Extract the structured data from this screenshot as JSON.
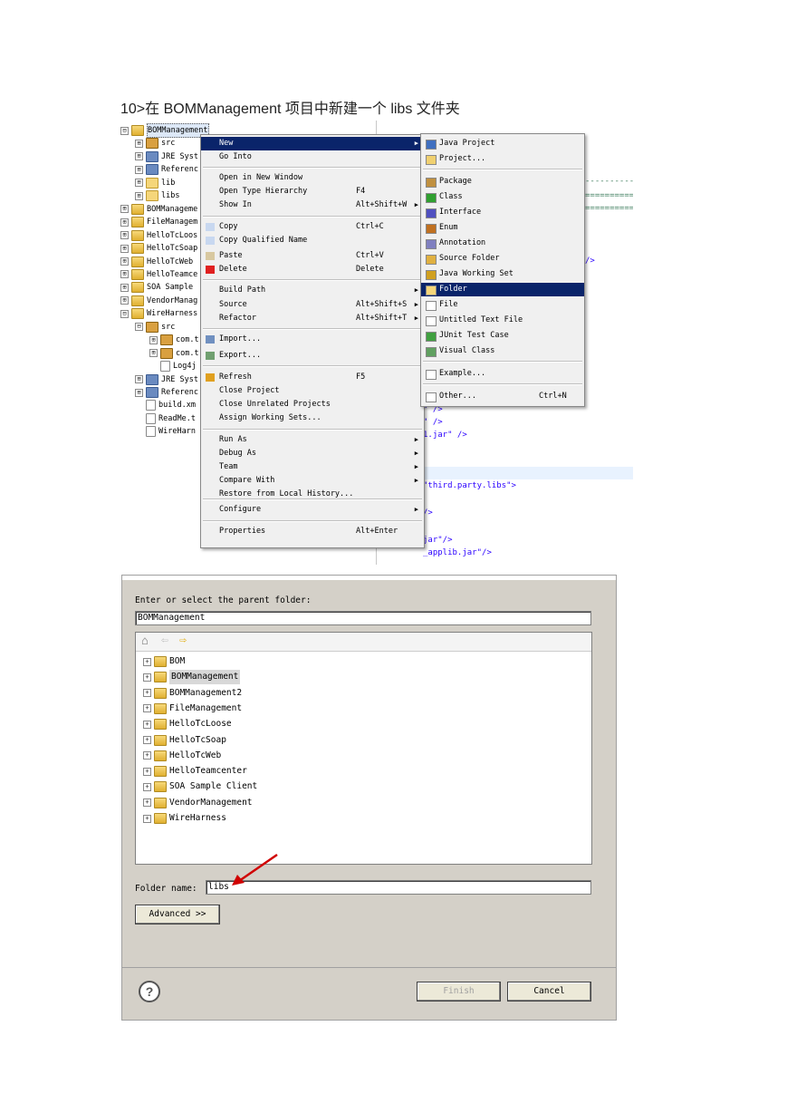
{
  "heading": "10>在 BOMManagement 项目中新建一个 libs 文件夹",
  "explorer": {
    "rows": [
      {
        "label": "BOMManagement",
        "exp": "⊟",
        "indent": 0,
        "icon": "proj"
      },
      {
        "label": "src",
        "exp": "⊞",
        "indent": 1,
        "icon": "pkg"
      },
      {
        "label": "JRE Syst",
        "exp": "⊞",
        "indent": 1,
        "icon": "lib"
      },
      {
        "label": "Referenc",
        "exp": "⊞",
        "indent": 1,
        "icon": "lib"
      },
      {
        "label": "lib",
        "exp": "⊞",
        "indent": 1,
        "icon": "fold"
      },
      {
        "label": "libs",
        "exp": "⊞",
        "indent": 1,
        "icon": "fold"
      },
      {
        "label": "BOMManageme",
        "exp": "⊞",
        "indent": 0,
        "icon": "proj"
      },
      {
        "label": "FileManagem",
        "exp": "⊞",
        "indent": 0,
        "icon": "proj"
      },
      {
        "label": "HelloTcLoos",
        "exp": "⊞",
        "indent": 0,
        "icon": "proj"
      },
      {
        "label": "HelloTcSoap",
        "exp": "⊞",
        "indent": 0,
        "icon": "proj"
      },
      {
        "label": "HelloTcWeb",
        "exp": "⊞",
        "indent": 0,
        "icon": "proj"
      },
      {
        "label": "HelloTeamce",
        "exp": "⊞",
        "indent": 0,
        "icon": "proj"
      },
      {
        "label": "SOA Sample",
        "exp": "⊞",
        "indent": 0,
        "icon": "proj"
      },
      {
        "label": "VendorManag",
        "exp": "⊞",
        "indent": 0,
        "icon": "proj"
      },
      {
        "label": "WireHarness",
        "exp": "⊟",
        "indent": 0,
        "icon": "proj"
      },
      {
        "label": "src",
        "exp": "⊟",
        "indent": 1,
        "icon": "pkg"
      },
      {
        "label": "com.t",
        "exp": "⊞",
        "indent": 2,
        "icon": "pkg"
      },
      {
        "label": "com.t",
        "exp": "⊞",
        "indent": 2,
        "icon": "pkg"
      },
      {
        "label": "Log4j",
        "exp": "",
        "indent": 2,
        "icon": "file"
      },
      {
        "label": "JRE Syst",
        "exp": "⊞",
        "indent": 1,
        "icon": "lib"
      },
      {
        "label": "Referenc",
        "exp": "⊞",
        "indent": 1,
        "icon": "lib"
      },
      {
        "label": "build.xm",
        "exp": "",
        "indent": 1,
        "icon": "file"
      },
      {
        "label": "ReadMe.t",
        "exp": "",
        "indent": 1,
        "icon": "file"
      },
      {
        "label": "WireHarn",
        "exp": "",
        "indent": 1,
        "icon": "file"
      }
    ]
  },
  "editor": {
    "dashes": "==========",
    "dashes2": "----------",
    "line_a": "/>",
    "line_b": "\" />",
    "line_c": "\" />",
    "line_d": "1.jar\" />",
    "line_e": "\"third.party.libs\">",
    "line_f": "/>",
    "line_g": "jar\"/>",
    "line_h": "_applib.jar\"/>"
  },
  "context_menu": {
    "items": [
      {
        "label": "New",
        "shortcut": "",
        "submenu": true,
        "highlight": true
      },
      {
        "label": "Go Into",
        "shortcut": "",
        "submenu": false
      },
      {
        "label": "Open in New Window",
        "shortcut": "",
        "submenu": false
      },
      {
        "label": "Open Type Hierarchy",
        "shortcut": "F4",
        "submenu": false
      },
      {
        "label": "Show In",
        "shortcut": "Alt+Shift+W",
        "submenu": true
      },
      {
        "label": "Copy",
        "shortcut": "Ctrl+C",
        "submenu": false
      },
      {
        "label": "Copy Qualified Name",
        "shortcut": "",
        "submenu": false
      },
      {
        "label": "Paste",
        "shortcut": "Ctrl+V",
        "submenu": false
      },
      {
        "label": "Delete",
        "shortcut": "Delete",
        "submenu": false
      },
      {
        "label": "Build Path",
        "shortcut": "",
        "submenu": true
      },
      {
        "label": "Source",
        "shortcut": "Alt+Shift+S",
        "submenu": true
      },
      {
        "label": "Refactor",
        "shortcut": "Alt+Shift+T",
        "submenu": true
      },
      {
        "label": "Import...",
        "shortcut": "",
        "submenu": false
      },
      {
        "label": "Export...",
        "shortcut": "",
        "submenu": false
      },
      {
        "label": "Refresh",
        "shortcut": "F5",
        "submenu": false
      },
      {
        "label": "Close Project",
        "shortcut": "",
        "submenu": false
      },
      {
        "label": "Close Unrelated Projects",
        "shortcut": "",
        "submenu": false
      },
      {
        "label": "Assign Working Sets...",
        "shortcut": "",
        "submenu": false
      },
      {
        "label": "Run As",
        "shortcut": "",
        "submenu": true
      },
      {
        "label": "Debug As",
        "shortcut": "",
        "submenu": true
      },
      {
        "label": "Team",
        "shortcut": "",
        "submenu": true
      },
      {
        "label": "Compare With",
        "shortcut": "",
        "submenu": true
      },
      {
        "label": "Restore from Local History...",
        "shortcut": "",
        "submenu": false
      },
      {
        "label": "Configure",
        "shortcut": "",
        "submenu": true
      },
      {
        "label": "Properties",
        "shortcut": "Alt+Enter",
        "submenu": false
      }
    ]
  },
  "new_submenu": {
    "items": [
      {
        "label": "Java Project",
        "shortcut": ""
      },
      {
        "label": "Project...",
        "shortcut": ""
      },
      {
        "label": "Package",
        "shortcut": ""
      },
      {
        "label": "Class",
        "shortcut": ""
      },
      {
        "label": "Interface",
        "shortcut": ""
      },
      {
        "label": "Enum",
        "shortcut": ""
      },
      {
        "label": "Annotation",
        "shortcut": ""
      },
      {
        "label": "Source Folder",
        "shortcut": ""
      },
      {
        "label": "Java Working Set",
        "shortcut": ""
      },
      {
        "label": "Folder",
        "shortcut": "",
        "highlight": true
      },
      {
        "label": "File",
        "shortcut": ""
      },
      {
        "label": "Untitled Text File",
        "shortcut": ""
      },
      {
        "label": "JUnit Test Case",
        "shortcut": ""
      },
      {
        "label": "Visual Class",
        "shortcut": ""
      },
      {
        "label": "Example...",
        "shortcut": ""
      },
      {
        "label": "Other...",
        "shortcut": "Ctrl+N"
      }
    ]
  },
  "dialog": {
    "parent_label": "Enter or select the parent folder:",
    "parent_value": "BOMManagement",
    "projects": [
      "BOM",
      "BOMManagement",
      "BOMManagement2",
      "FileManagement",
      "HelloTcLoose",
      "HelloTcSoap",
      "HelloTcWeb",
      "HelloTeamcenter",
      "SOA Sample Client",
      "VendorManagement",
      "WireHarness"
    ],
    "selected_project": "BOMManagement",
    "folder_label": "Folder name:",
    "folder_value": "libs",
    "advanced": "Advanced >>",
    "finish": "Finish",
    "cancel": "Cancel",
    "help": "?",
    "nav_back": "⇦",
    "nav_forward": "⇨",
    "home_icon": "⌂",
    "accent": "#0a246a",
    "arrow_color": "#d00000"
  }
}
